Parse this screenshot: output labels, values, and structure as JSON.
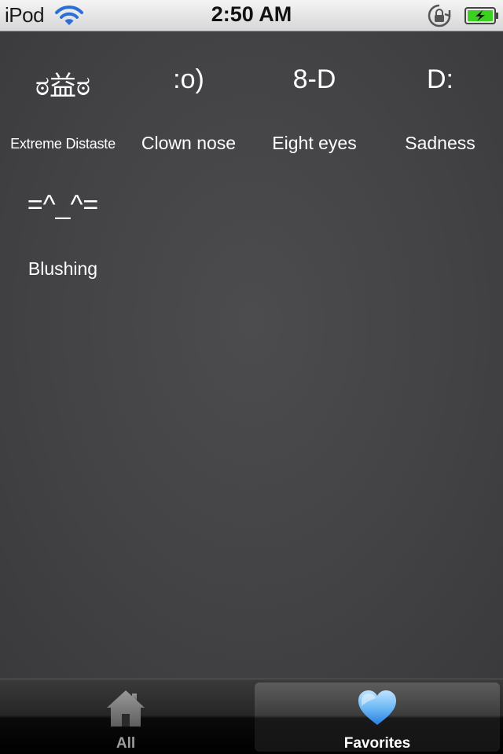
{
  "status_bar": {
    "carrier": "iPod",
    "time": "2:50 AM",
    "icons": [
      "wifi-icon",
      "rotation-lock-icon",
      "battery-charging-icon"
    ]
  },
  "favorites": [
    {
      "emoticon": "ಠ益ಠ",
      "label": "Extreme Distaste"
    },
    {
      "emoticon": ":o)",
      "label": "Clown nose"
    },
    {
      "emoticon": "8-D",
      "label": "Eight eyes"
    },
    {
      "emoticon": "D:",
      "label": "Sadness"
    },
    {
      "emoticon": "=^_^=",
      "label": "Blushing"
    }
  ],
  "tab_bar": {
    "selected": "favorites",
    "tabs": [
      {
        "label": "All",
        "icon": "house-icon"
      },
      {
        "label": "Favorites",
        "icon": "heart-icon"
      }
    ]
  },
  "colors": {
    "background": "#434345",
    "text": "#ffffff",
    "heart": "#4aa3f0",
    "battery": "#3ad21f"
  }
}
